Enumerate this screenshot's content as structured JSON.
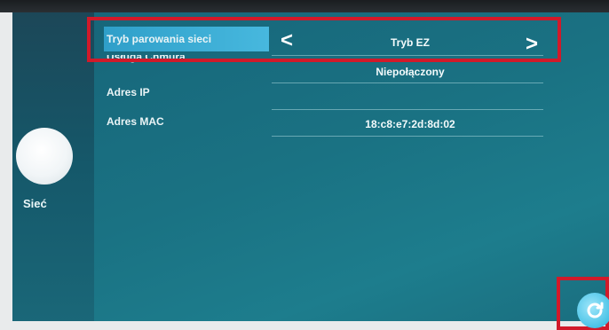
{
  "sidebar": {
    "label": "Sieć",
    "icon": "network-icon"
  },
  "settings": {
    "mode": {
      "label": "Tryb parowania sieci",
      "value": "Tryb EZ",
      "prev": "<",
      "next": ">"
    },
    "cloud": {
      "label": "Usługa Chmura",
      "value": "Niepołączony"
    },
    "ip": {
      "label": "Adres IP",
      "value": ""
    },
    "mac": {
      "label": "Adres MAC",
      "value": "18:c8:e7:2d:8d:02"
    }
  },
  "colors": {
    "highlight": "#d11a2a",
    "selected": "#3aaed6",
    "panel": "#1a7283"
  }
}
